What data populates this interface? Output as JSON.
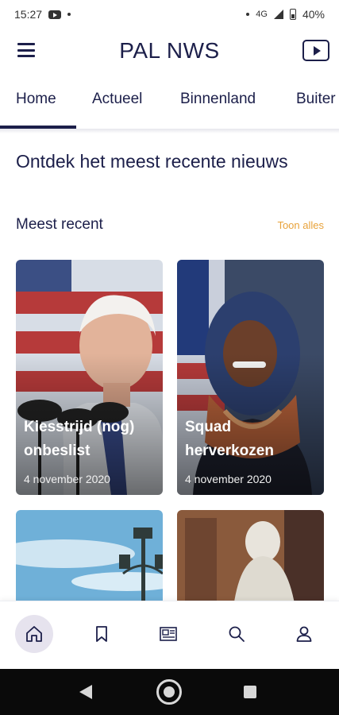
{
  "status": {
    "time": "15:27",
    "network": "4G",
    "battery": "40%"
  },
  "app": {
    "title": "PAL NWS"
  },
  "tabs": [
    {
      "label": "Home",
      "active": true
    },
    {
      "label": "Actueel"
    },
    {
      "label": "Binnenland"
    },
    {
      "label": "Buiter"
    }
  ],
  "headline": "Ontdek het meest recente nieuws",
  "section": {
    "title": "Meest recent",
    "show_all": "Toon alles"
  },
  "articles": [
    {
      "title": "Kiesstrijd (nog) onbeslist",
      "date": "4 november 2020"
    },
    {
      "title": "Squad herverkozen",
      "date": "4 november 2020"
    }
  ],
  "bottom_nav": [
    {
      "icon": "home-icon",
      "active": true
    },
    {
      "icon": "bookmark-icon"
    },
    {
      "icon": "newspaper-icon"
    },
    {
      "icon": "search-icon"
    },
    {
      "icon": "profile-icon"
    }
  ],
  "colors": {
    "primary": "#1c1f4a",
    "accent": "#e8a23a",
    "active_bg": "#e6e3ee"
  }
}
